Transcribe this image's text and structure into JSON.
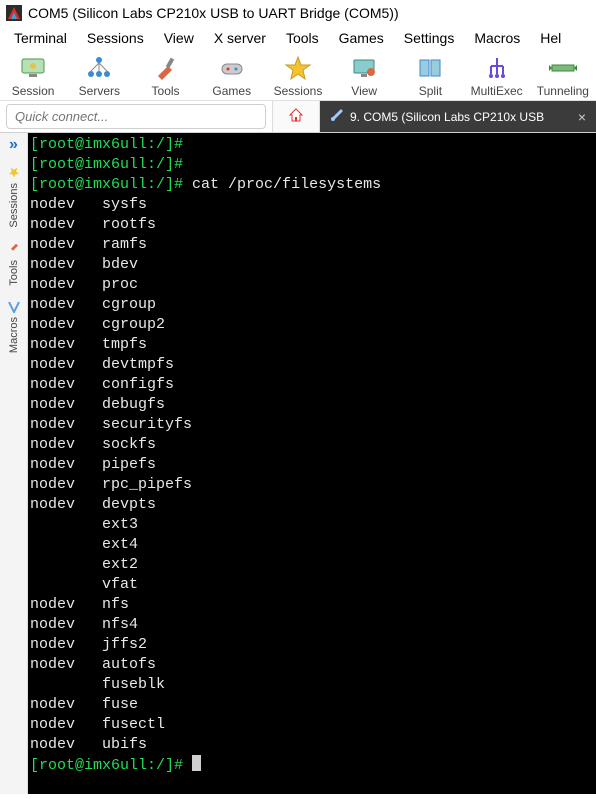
{
  "window": {
    "title": "COM5  (Silicon Labs CP210x USB to UART Bridge (COM5))"
  },
  "menu": {
    "items": [
      "Terminal",
      "Sessions",
      "View",
      "X server",
      "Tools",
      "Games",
      "Settings",
      "Macros",
      "Hel"
    ]
  },
  "toolbar": {
    "items": [
      {
        "name": "session",
        "label": "Session"
      },
      {
        "name": "servers",
        "label": "Servers"
      },
      {
        "name": "tools",
        "label": "Tools"
      },
      {
        "name": "games",
        "label": "Games"
      },
      {
        "name": "sessions",
        "label": "Sessions"
      },
      {
        "name": "view",
        "label": "View"
      },
      {
        "name": "split",
        "label": "Split"
      },
      {
        "name": "multiexec",
        "label": "MultiExec"
      },
      {
        "name": "tunneling",
        "label": "Tunneling"
      }
    ]
  },
  "quick_connect": {
    "placeholder": "Quick connect..."
  },
  "tabs": {
    "active": {
      "label": "9. COM5  (Silicon Labs CP210x USB"
    }
  },
  "sidepanel": {
    "tabs": [
      "Sessions",
      "Tools",
      "Macros"
    ]
  },
  "terminal": {
    "prompt": "[root@imx6ull:/]#",
    "command": "cat /proc/filesystems",
    "filesystems": [
      {
        "flag": "nodev",
        "name": "sysfs"
      },
      {
        "flag": "nodev",
        "name": "rootfs"
      },
      {
        "flag": "nodev",
        "name": "ramfs"
      },
      {
        "flag": "nodev",
        "name": "bdev"
      },
      {
        "flag": "nodev",
        "name": "proc"
      },
      {
        "flag": "nodev",
        "name": "cgroup"
      },
      {
        "flag": "nodev",
        "name": "cgroup2"
      },
      {
        "flag": "nodev",
        "name": "tmpfs"
      },
      {
        "flag": "nodev",
        "name": "devtmpfs"
      },
      {
        "flag": "nodev",
        "name": "configfs"
      },
      {
        "flag": "nodev",
        "name": "debugfs"
      },
      {
        "flag": "nodev",
        "name": "securityfs"
      },
      {
        "flag": "nodev",
        "name": "sockfs"
      },
      {
        "flag": "nodev",
        "name": "pipefs"
      },
      {
        "flag": "nodev",
        "name": "rpc_pipefs"
      },
      {
        "flag": "nodev",
        "name": "devpts"
      },
      {
        "flag": "",
        "name": "ext3"
      },
      {
        "flag": "",
        "name": "ext4"
      },
      {
        "flag": "",
        "name": "ext2"
      },
      {
        "flag": "",
        "name": "vfat"
      },
      {
        "flag": "nodev",
        "name": "nfs"
      },
      {
        "flag": "nodev",
        "name": "nfs4"
      },
      {
        "flag": "nodev",
        "name": "jffs2"
      },
      {
        "flag": "nodev",
        "name": "autofs"
      },
      {
        "flag": "",
        "name": "fuseblk"
      },
      {
        "flag": "nodev",
        "name": "fuse"
      },
      {
        "flag": "nodev",
        "name": "fusectl"
      },
      {
        "flag": "nodev",
        "name": "ubifs"
      }
    ]
  }
}
